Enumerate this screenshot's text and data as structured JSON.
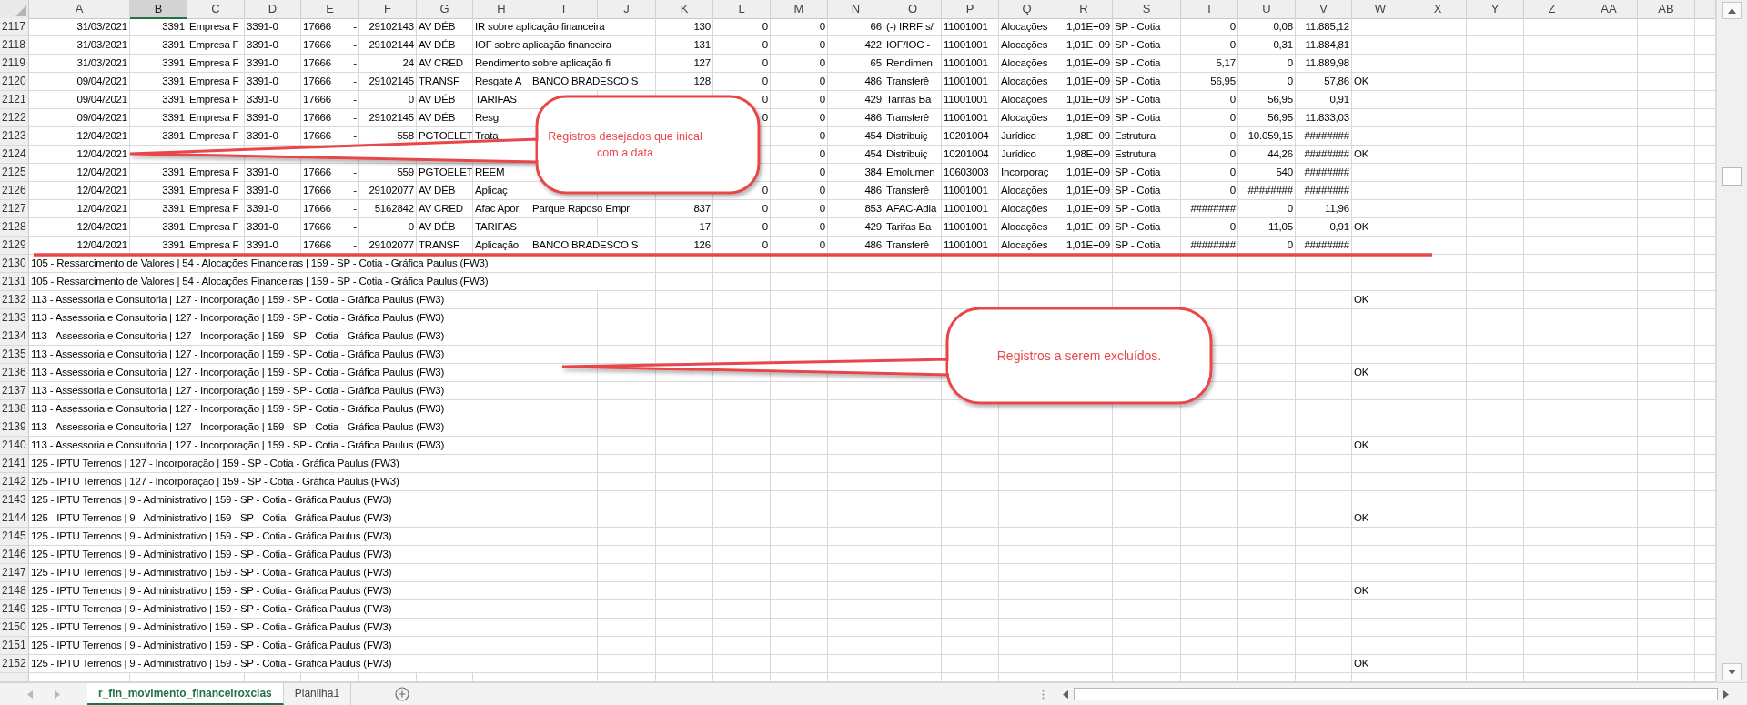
{
  "columns": [
    {
      "label": "A",
      "selected": false
    },
    {
      "label": "B",
      "selected": true
    },
    {
      "label": "C",
      "selected": false
    },
    {
      "label": "D",
      "selected": false
    },
    {
      "label": "E",
      "selected": false
    },
    {
      "label": "F",
      "selected": false
    },
    {
      "label": "G",
      "selected": false
    },
    {
      "label": "H",
      "selected": false
    },
    {
      "label": "I",
      "selected": false
    },
    {
      "label": "J",
      "selected": false
    },
    {
      "label": "K",
      "selected": false
    },
    {
      "label": "L",
      "selected": false
    },
    {
      "label": "M",
      "selected": false
    },
    {
      "label": "N",
      "selected": false
    },
    {
      "label": "O",
      "selected": false
    },
    {
      "label": "P",
      "selected": false
    },
    {
      "label": "Q",
      "selected": false
    },
    {
      "label": "R",
      "selected": false
    },
    {
      "label": "S",
      "selected": false
    },
    {
      "label": "T",
      "selected": false
    },
    {
      "label": "U",
      "selected": false
    },
    {
      "label": "V",
      "selected": false
    },
    {
      "label": "W",
      "selected": false
    },
    {
      "label": "X",
      "selected": false
    },
    {
      "label": "Y",
      "selected": false
    },
    {
      "label": "Z",
      "selected": false
    },
    {
      "label": "AA",
      "selected": false
    },
    {
      "label": "AB",
      "selected": false
    }
  ],
  "rows": [
    {
      "number": "2117",
      "kind": "record",
      "cells": {
        "A": "31/03/2021",
        "B": "3391",
        "C": "Empresa F",
        "D": "3391-0",
        "E": [
          "17666",
          "-"
        ],
        "F": "29102143",
        "G": "AV DÉB",
        "H": "IR sobre aplicação financeira",
        "K": "130",
        "L": "0",
        "M": "0",
        "N": "66",
        "O": "(-) IRRF s/",
        "P": "11001001",
        "Q": "Alocações",
        "R": "1,01E+09",
        "S": "SP - Cotia",
        "T": "0",
        "U": "0,08",
        "V": "11.885,12"
      }
    },
    {
      "number": "2118",
      "kind": "record",
      "cells": {
        "A": "31/03/2021",
        "B": "3391",
        "C": "Empresa F",
        "D": "3391-0",
        "E": [
          "17666",
          "-"
        ],
        "F": "29102144",
        "G": "AV DÉB",
        "H": "IOF sobre aplicação financeira",
        "K": "131",
        "L": "0",
        "M": "0",
        "N": "422",
        "O": "IOF/IOC -",
        "P": "11001001",
        "Q": "Alocações",
        "R": "1,01E+09",
        "S": "SP - Cotia",
        "T": "0",
        "U": "0,31",
        "V": "11.884,81"
      }
    },
    {
      "number": "2119",
      "kind": "record",
      "cells": {
        "A": "31/03/2021",
        "B": "3391",
        "C": "Empresa F",
        "D": "3391-0",
        "E": [
          "17666",
          "-"
        ],
        "F": "24",
        "G": "AV CRED",
        "H": "Rendimento sobre aplicação fi",
        "K": "127",
        "L": "0",
        "M": "0",
        "N": "65",
        "O": "Rendimen",
        "P": "11001001",
        "Q": "Alocações",
        "R": "1,01E+09",
        "S": "SP - Cotia",
        "T": "5,17",
        "U": "0",
        "V": "11.889,98"
      }
    },
    {
      "number": "2120",
      "kind": "record",
      "cells": {
        "A": "09/04/2021",
        "B": "3391",
        "C": "Empresa F",
        "D": "3391-0",
        "E": [
          "17666",
          "-"
        ],
        "F": "29102145",
        "G": "TRANSF",
        "H": "Resgate A",
        "I": "BANCO BRADESCO S",
        "K": "128",
        "L": "0",
        "M": "0",
        "N": "486",
        "O": "Transferê",
        "P": "11001001",
        "Q": "Alocações",
        "R": "1,01E+09",
        "S": "SP - Cotia",
        "T": "56,95",
        "U": "0",
        "V": "57,86",
        "W": "OK"
      }
    },
    {
      "number": "2121",
      "kind": "record",
      "cells": {
        "A": "09/04/2021",
        "B": "3391",
        "C": "Empresa F",
        "D": "3391-0",
        "E": [
          "17666",
          "-"
        ],
        "F": "0",
        "G": "AV DÉB",
        "H": "TARIFAS",
        "L": "0",
        "M": "0",
        "N": "429",
        "O": "Tarifas Ba",
        "P": "11001001",
        "Q": "Alocações",
        "R": "1,01E+09",
        "S": "SP - Cotia",
        "T": "0",
        "U": "56,95",
        "V": "0,91"
      }
    },
    {
      "number": "2122",
      "kind": "record",
      "cells": {
        "A": "09/04/2021",
        "B": "3391",
        "C": "Empresa F",
        "D": "3391-0",
        "E": [
          "17666",
          "-"
        ],
        "F": "29102145",
        "G": "AV DÉB",
        "H": "Resg",
        "L": "0",
        "M": "0",
        "N": "486",
        "O": "Transferê",
        "P": "11001001",
        "Q": "Alocações",
        "R": "1,01E+09",
        "S": "SP - Cotia",
        "T": "0",
        "U": "56,95",
        "V": "11.833,03"
      }
    },
    {
      "number": "2123",
      "kind": "record",
      "cells": {
        "A": "12/04/2021",
        "B": "3391",
        "C": "Empresa F",
        "D": "3391-0",
        "E": [
          "17666",
          "-"
        ],
        "F": "558",
        "G": "PGTOELET",
        "H": "Trata",
        "M": "0",
        "N": "454",
        "O": "Distribuiç",
        "P": "10201004",
        "Q": "Jurídico",
        "R": "1,98E+09",
        "S": "Estrutura",
        "T": "0",
        "U": "10.059,15",
        "V": "########"
      }
    },
    {
      "number": "2124",
      "kind": "record",
      "cells": {
        "A": "12/04/2021",
        "M": "0",
        "N": "454",
        "O": "Distribuiç",
        "P": "10201004",
        "Q": "Jurídico",
        "R": "1,98E+09",
        "S": "Estrutura",
        "T": "0",
        "U": "44,26",
        "V": "########",
        "W": "OK"
      }
    },
    {
      "number": "2125",
      "kind": "record",
      "cells": {
        "A": "12/04/2021",
        "B": "3391",
        "C": "Empresa F",
        "D": "3391-0",
        "E": [
          "17666",
          "-"
        ],
        "F": "559",
        "G": "PGTOELET",
        "H": "REEM",
        "M": "0",
        "N": "384",
        "O": "Emolumen",
        "P": "10603003",
        "Q": "Incorporaç",
        "R": "1,01E+09",
        "S": "SP - Cotia",
        "T": "0",
        "U": "540",
        "V": "########"
      }
    },
    {
      "number": "2126",
      "kind": "record",
      "cells": {
        "A": "12/04/2021",
        "B": "3391",
        "C": "Empresa F",
        "D": "3391-0",
        "E": [
          "17666",
          "-"
        ],
        "F": "29102077",
        "G": "AV DÉB",
        "H": "Aplicaç",
        "L": "0",
        "M": "0",
        "N": "486",
        "O": "Transferê",
        "P": "11001001",
        "Q": "Alocações",
        "R": "1,01E+09",
        "S": "SP - Cotia",
        "T": "0",
        "U": "########",
        "V": "########"
      }
    },
    {
      "number": "2127",
      "kind": "record",
      "cells": {
        "A": "12/04/2021",
        "B": "3391",
        "C": "Empresa F",
        "D": "3391-0",
        "E": [
          "17666",
          "-"
        ],
        "F": "5162842",
        "G": "AV CRED",
        "H": "Afac Apor",
        "I": "Parque Raposo Empr",
        "K": "837",
        "L": "0",
        "M": "0",
        "N": "853",
        "O": "AFAC-Adia",
        "P": "11001001",
        "Q": "Alocações",
        "R": "1,01E+09",
        "S": "SP - Cotia",
        "T": "########",
        "U": "0",
        "V": "11,96"
      }
    },
    {
      "number": "2128",
      "kind": "record",
      "cells": {
        "A": "12/04/2021",
        "B": "3391",
        "C": "Empresa F",
        "D": "3391-0",
        "E": [
          "17666",
          "-"
        ],
        "F": "0",
        "G": "AV DÉB",
        "H": "TARIFAS",
        "K": "17",
        "L": "0",
        "M": "0",
        "N": "429",
        "O": "Tarifas Ba",
        "P": "11001001",
        "Q": "Alocações",
        "R": "1,01E+09",
        "S": "SP - Cotia",
        "T": "0",
        "U": "11,05",
        "V": "0,91",
        "W": "OK"
      }
    },
    {
      "number": "2129",
      "kind": "record",
      "cells": {
        "A": "12/04/2021",
        "B": "3391",
        "C": "Empresa F",
        "D": "3391-0",
        "E": [
          "17666",
          "-"
        ],
        "F": "29102077",
        "G": "TRANSF",
        "H": "Aplicação",
        "I": "BANCO BRADESCO S",
        "K": "126",
        "L": "0",
        "M": "0",
        "N": "486",
        "O": "Transferê",
        "P": "11001001",
        "Q": "Alocações",
        "R": "1,01E+09",
        "S": "SP - Cotia",
        "T": "########",
        "U": "0",
        "V": "########"
      }
    },
    {
      "number": "2130",
      "kind": "summary",
      "cells": {
        "A": "105 - Ressarcimento de Valores | 54 - Alocações Financeiras | 159 - SP - Cotia - Gráfica Paulus (FW3)"
      }
    },
    {
      "number": "2131",
      "kind": "summary",
      "cells": {
        "A": "105 - Ressarcimento de Valores | 54 - Alocações Financeiras | 159 - SP - Cotia - Gráfica Paulus (FW3)"
      }
    },
    {
      "number": "2132",
      "kind": "summary",
      "cells": {
        "A": "113 - Assessoria e Consultoria | 127 - Incorporação | 159 - SP - Cotia - Gráfica Paulus (FW3)",
        "W": "OK"
      }
    },
    {
      "number": "2133",
      "kind": "summary",
      "cells": {
        "A": "113 - Assessoria e Consultoria | 127 - Incorporação | 159 - SP - Cotia - Gráfica Paulus (FW3)"
      }
    },
    {
      "number": "2134",
      "kind": "summary",
      "cells": {
        "A": "113 - Assessoria e Consultoria | 127 - Incorporação | 159 - SP - Cotia - Gráfica Paulus (FW3)"
      }
    },
    {
      "number": "2135",
      "kind": "summary",
      "cells": {
        "A": "113 - Assessoria e Consultoria | 127 - Incorporação | 159 - SP - Cotia - Gráfica Paulus (FW3)"
      }
    },
    {
      "number": "2136",
      "kind": "summary",
      "cells": {
        "A": "113 - Assessoria e Consultoria | 127 - Incorporação | 159 - SP - Cotia - Gráfica Paulus (FW3)",
        "W": "OK"
      }
    },
    {
      "number": "2137",
      "kind": "summary",
      "cells": {
        "A": "113 - Assessoria e Consultoria | 127 - Incorporação | 159 - SP - Cotia - Gráfica Paulus (FW3)"
      }
    },
    {
      "number": "2138",
      "kind": "summary",
      "cells": {
        "A": "113 - Assessoria e Consultoria | 127 - Incorporação | 159 - SP - Cotia - Gráfica Paulus (FW3)"
      }
    },
    {
      "number": "2139",
      "kind": "summary",
      "cells": {
        "A": "113 - Assessoria e Consultoria | 127 - Incorporação | 159 - SP - Cotia - Gráfica Paulus (FW3)"
      }
    },
    {
      "number": "2140",
      "kind": "summary",
      "cells": {
        "A": "113 - Assessoria e Consultoria | 127 - Incorporação | 159 - SP - Cotia - Gráfica Paulus (FW3)",
        "W": "OK"
      }
    },
    {
      "number": "2141",
      "kind": "summary",
      "cells": {
        "A": "125 - IPTU Terrenos | 127 - Incorporação | 159 - SP - Cotia - Gráfica Paulus (FW3)"
      }
    },
    {
      "number": "2142",
      "kind": "summary",
      "cells": {
        "A": "125 - IPTU Terrenos | 127 - Incorporação | 159 - SP - Cotia - Gráfica Paulus (FW3)"
      }
    },
    {
      "number": "2143",
      "kind": "summary",
      "cells": {
        "A": "125 - IPTU Terrenos | 9 - Administrativo | 159 - SP - Cotia - Gráfica Paulus (FW3)"
      }
    },
    {
      "number": "2144",
      "kind": "summary",
      "cells": {
        "A": "125 - IPTU Terrenos | 9 - Administrativo | 159 - SP - Cotia - Gráfica Paulus (FW3)",
        "W": "OK"
      }
    },
    {
      "number": "2145",
      "kind": "summary",
      "cells": {
        "A": "125 - IPTU Terrenos | 9 - Administrativo | 159 - SP - Cotia - Gráfica Paulus (FW3)"
      }
    },
    {
      "number": "2146",
      "kind": "summary",
      "cells": {
        "A": "125 - IPTU Terrenos | 9 - Administrativo | 159 - SP - Cotia - Gráfica Paulus (FW3)"
      }
    },
    {
      "number": "2147",
      "kind": "summary",
      "cells": {
        "A": "125 - IPTU Terrenos | 9 - Administrativo | 159 - SP - Cotia - Gráfica Paulus (FW3)"
      }
    },
    {
      "number": "2148",
      "kind": "summary",
      "cells": {
        "A": "125 - IPTU Terrenos | 9 - Administrativo | 159 - SP - Cotia - Gráfica Paulus (FW3)",
        "W": "OK"
      }
    },
    {
      "number": "2149",
      "kind": "summary",
      "cells": {
        "A": "125 - IPTU Terrenos | 9 - Administrativo | 159 - SP - Cotia - Gráfica Paulus (FW3)"
      }
    },
    {
      "number": "2150",
      "kind": "summary",
      "cells": {
        "A": "125 - IPTU Terrenos | 9 - Administrativo | 159 - SP - Cotia - Gráfica Paulus (FW3)"
      }
    },
    {
      "number": "2151",
      "kind": "summary",
      "cells": {
        "A": "125 - IPTU Terrenos | 9 - Administrativo | 159 - SP - Cotia - Gráfica Paulus (FW3)"
      }
    },
    {
      "number": "2152",
      "kind": "summary",
      "cells": {
        "A": "125 - IPTU Terrenos | 9 - Administrativo | 159 - SP - Cotia - Gráfica Paulus (FW3)",
        "W": "OK"
      }
    }
  ],
  "callouts": [
    {
      "text": "Registros desejados que inical com a data"
    },
    {
      "text": "Registros a serem excluídos."
    }
  ],
  "sheet_tabs": [
    {
      "label": "r_fin_movimento_financeiroxclas",
      "selected": true
    },
    {
      "label": "Planilha1",
      "selected": false
    }
  ]
}
